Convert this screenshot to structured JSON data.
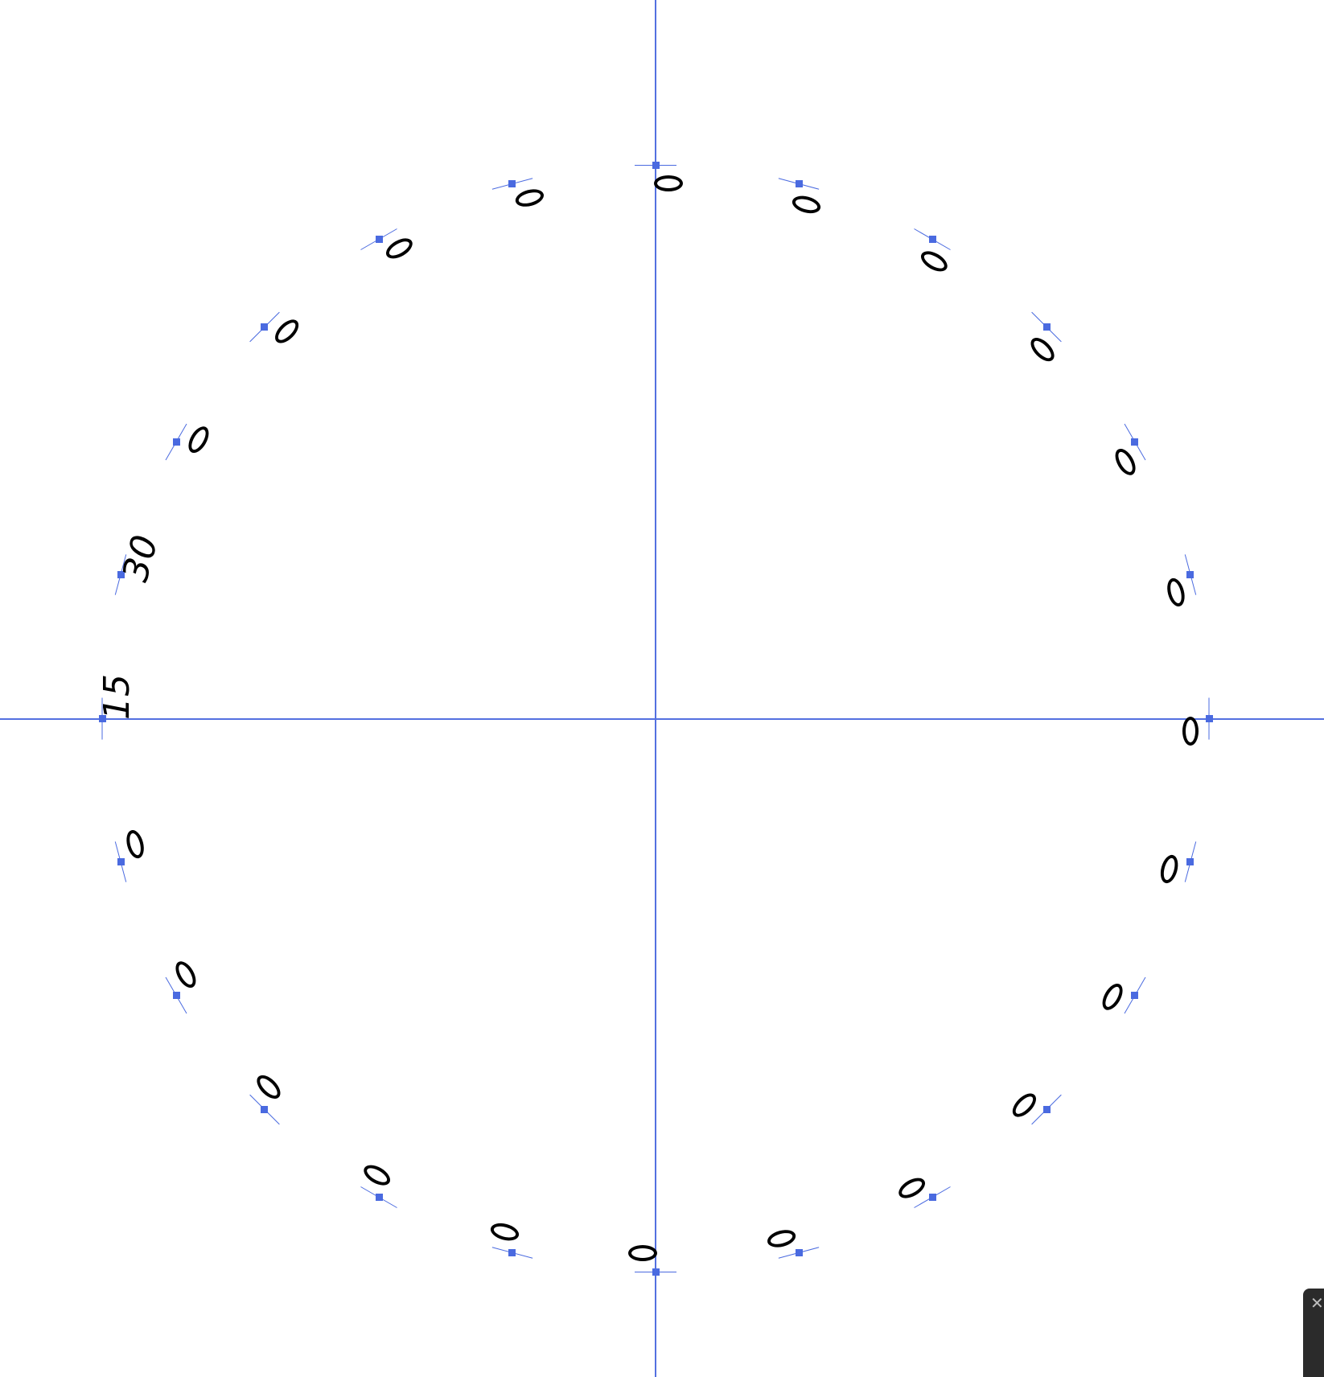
{
  "canvas": {
    "guide_color": "#4a6ae0",
    "text_color": "#000000",
    "background": "#ffffff"
  },
  "labels": [
    {
      "text": "0"
    },
    {
      "text": "0"
    },
    {
      "text": "0"
    },
    {
      "text": "0"
    },
    {
      "text": "0"
    },
    {
      "text": "0"
    },
    {
      "text": "0"
    },
    {
      "text": "0"
    },
    {
      "text": "0"
    },
    {
      "text": "0"
    },
    {
      "text": "0"
    },
    {
      "text": "0"
    },
    {
      "text": "0"
    },
    {
      "text": "0"
    },
    {
      "text": "0"
    },
    {
      "text": "0"
    },
    {
      "text": "0"
    },
    {
      "text": "0"
    },
    {
      "text": "15"
    },
    {
      "text": "30"
    },
    {
      "text": "0"
    },
    {
      "text": "0"
    },
    {
      "text": "0"
    },
    {
      "text": "0"
    }
  ],
  "corner_panel": {
    "close_icon": "close-icon",
    "close_glyph": "✕"
  }
}
